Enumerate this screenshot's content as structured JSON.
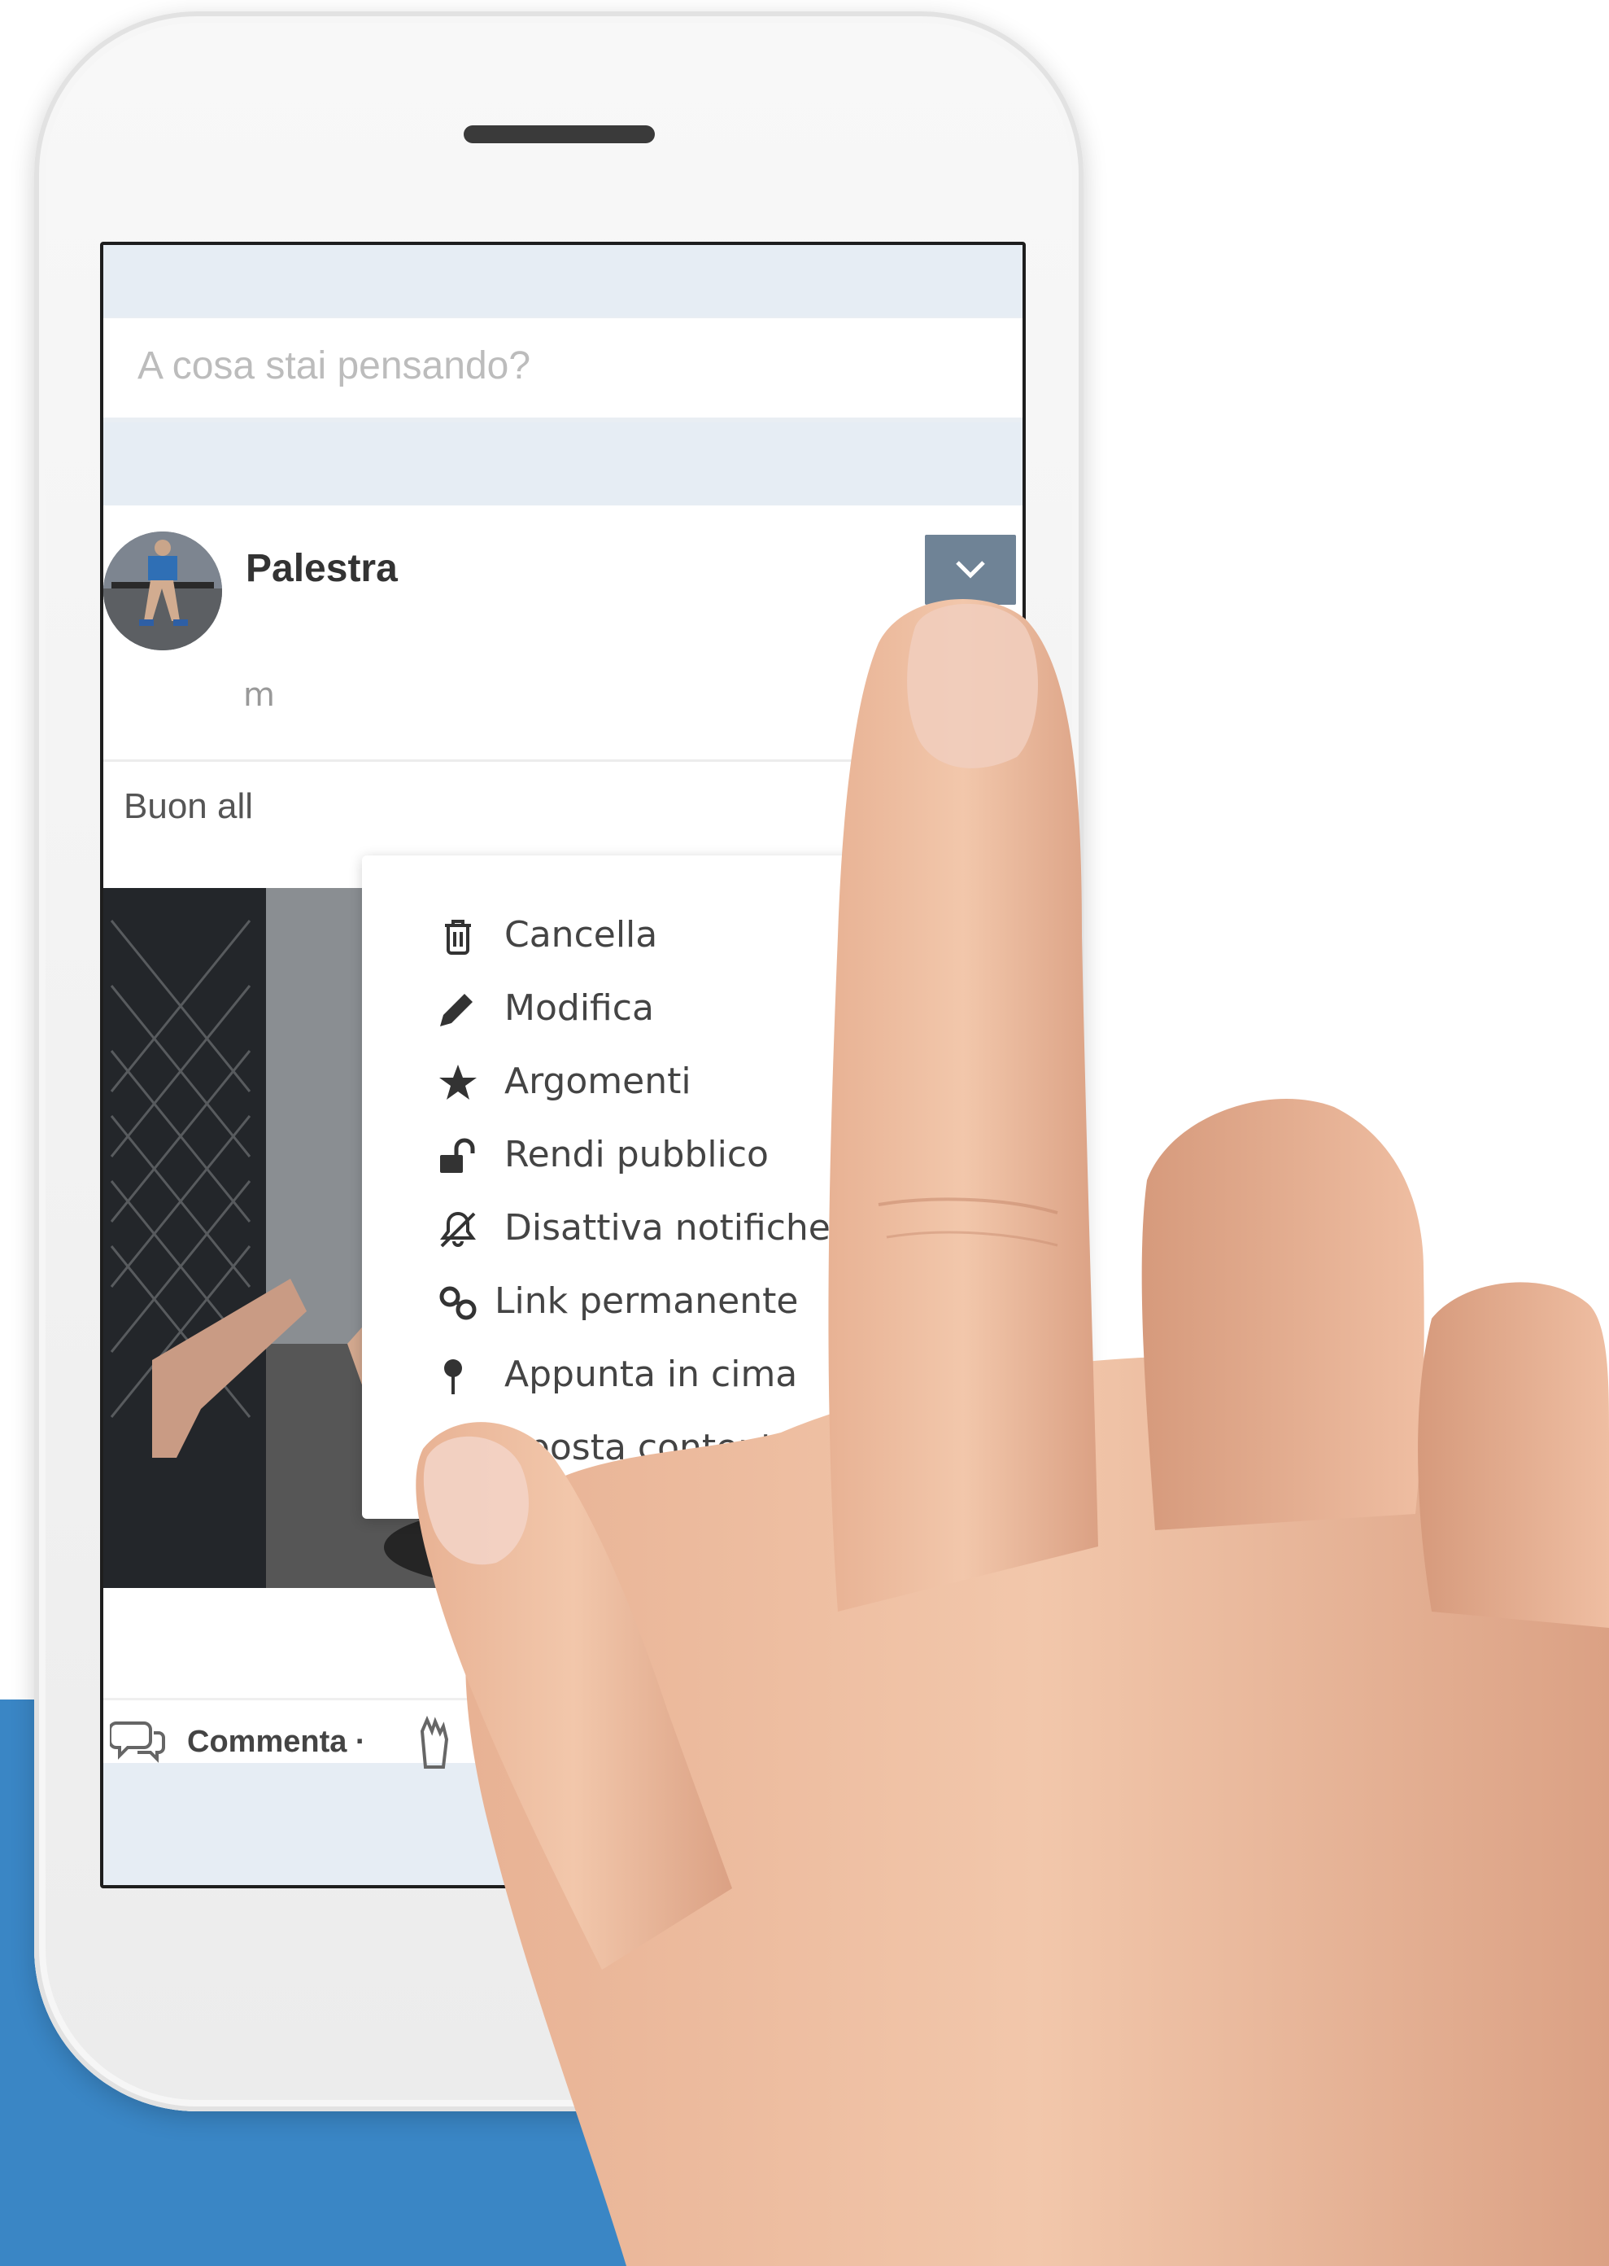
{
  "composer": {
    "placeholder": "A cosa stai pensando?"
  },
  "post": {
    "author": "Palestra",
    "text_partial": "Buon all",
    "stray_text": "m"
  },
  "menu": {
    "items": [
      {
        "label": "Cancella",
        "icon": "trash-icon"
      },
      {
        "label": "Modifica",
        "icon": "pencil-icon"
      },
      {
        "label": "Argomenti",
        "icon": "star-icon"
      },
      {
        "label": "Rendi pubblico",
        "icon": "unlock-icon"
      },
      {
        "label": "Disattiva notifiche",
        "icon": "bell-slash-icon"
      },
      {
        "label": "Link permanente",
        "icon": "link-icon"
      },
      {
        "label": "Appunta in cima",
        "icon": "pin-icon"
      },
      {
        "label": "Sposta contentuto",
        "icon": "arrows-horizontal-icon"
      }
    ]
  },
  "actions": {
    "comment_label": "Commenta ·"
  },
  "colors": {
    "accent_blue": "#3a86c5",
    "dropdown_button": "#6f8396"
  }
}
